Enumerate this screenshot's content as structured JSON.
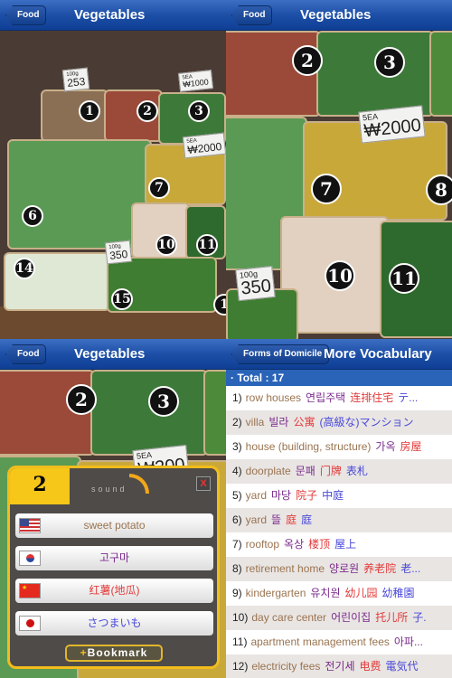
{
  "panels": [
    {
      "back": "Food",
      "title": "Vegetables",
      "markers": [
        "1",
        "2",
        "3",
        "6",
        "7",
        "10",
        "11",
        "14",
        "15",
        "1"
      ],
      "tags": [
        {
          "unit": "100g",
          "price": "253"
        },
        {
          "unit": "5EA",
          "price": "₩1000"
        },
        {
          "unit": "5EA",
          "price": "₩2000"
        },
        {
          "unit": "100g",
          "price": "350"
        }
      ]
    },
    {
      "back": "Food",
      "title": "Vegetables",
      "markers": [
        "2",
        "3",
        "7",
        "8",
        "10",
        "11"
      ],
      "tags": [
        {
          "unit": "5EA",
          "price": "₩2000"
        },
        {
          "unit": "100g",
          "price": "350"
        }
      ]
    },
    {
      "back": "Food",
      "title": "Vegetables",
      "markers": [
        "2",
        "3"
      ],
      "tags": [
        {
          "unit": "5EA",
          "price": "₩200"
        }
      ]
    }
  ],
  "popup": {
    "number": "2",
    "sound_label": "sound",
    "close": "X",
    "bookmark_plus": "+",
    "bookmark": "Bookmark",
    "items": [
      {
        "lang": "en",
        "flag": "us-flag",
        "text": "sweet potato",
        "color": "#9a7450"
      },
      {
        "lang": "ko",
        "flag": "korea-flag",
        "text": "고구마",
        "color": "#7a2a8c"
      },
      {
        "lang": "zh",
        "flag": "china-flag",
        "text": "红薯(地瓜)",
        "color": "#e23a3a"
      },
      {
        "lang": "ja",
        "flag": "japan-flag",
        "text": "さつまいも",
        "color": "#4848d8"
      }
    ]
  },
  "vocab": {
    "back": "Forms of Domicile",
    "title": "More Vocabulary",
    "total": "· Total : 17",
    "rows": [
      {
        "n": "1)",
        "en": "row houses",
        "ko": "연립주택",
        "zh": "连排住宅",
        "ja": "テ..."
      },
      {
        "n": "2)",
        "en": "villa",
        "ko": "빌라",
        "zh": "公寓",
        "ja": "(高級な)マンション"
      },
      {
        "n": "3)",
        "en": "house (building, structure)",
        "ko": "가옥",
        "zh": "房屋",
        "ja": ""
      },
      {
        "n": "4)",
        "en": "doorplate",
        "ko": "문패",
        "zh": "门牌",
        "ja": "表札"
      },
      {
        "n": "5)",
        "en": "yard",
        "ko": "마당",
        "zh": "院子",
        "ja": "中庭"
      },
      {
        "n": "6)",
        "en": "yard",
        "ko": "뜰",
        "zh": "庭",
        "ja": "庭"
      },
      {
        "n": "7)",
        "en": "rooftop",
        "ko": "옥상",
        "zh": "楼顶",
        "ja": "屋上"
      },
      {
        "n": "8)",
        "en": "retirement home",
        "ko": "양로원",
        "zh": "养老院",
        "ja": "老..."
      },
      {
        "n": "9)",
        "en": "kindergarten",
        "ko": "유치원",
        "zh": "幼儿园",
        "ja": "幼稚園"
      },
      {
        "n": "10)",
        "en": "day care center",
        "ko": "어린이집",
        "zh": "托儿所",
        "ja": "子."
      },
      {
        "n": "11)",
        "en": "apartment management fees",
        "ko": "아파...",
        "zh": "",
        "ja": ""
      },
      {
        "n": "12)",
        "en": "electricity fees",
        "ko": "전기세",
        "zh": "电费",
        "ja": "電気代"
      }
    ]
  }
}
